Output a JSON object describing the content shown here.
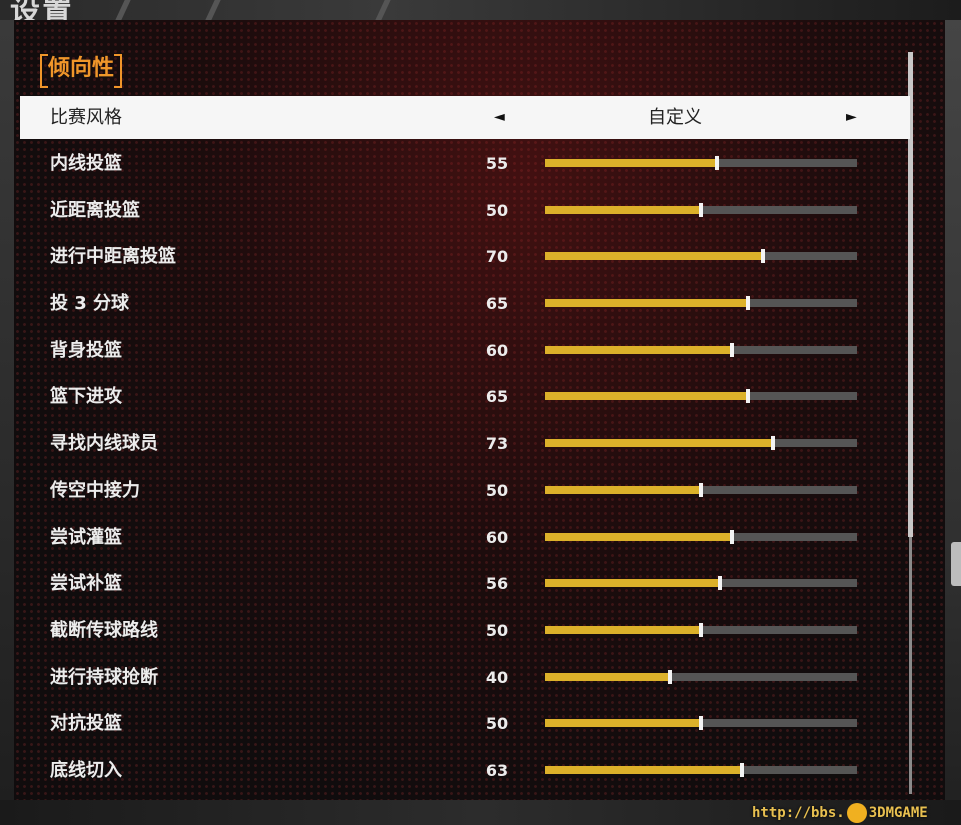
{
  "header": {
    "title_fragment": "设置"
  },
  "section": {
    "title": "倾向性"
  },
  "style_selector": {
    "label": "比赛风格",
    "value": "自定义",
    "left_arrow": "◄",
    "right_arrow": "►"
  },
  "sliders": [
    {
      "label": "内线投篮",
      "value": 55
    },
    {
      "label": "近距离投篮",
      "value": 50
    },
    {
      "label": "进行中距离投篮",
      "value": 70
    },
    {
      "label": "投 3 分球",
      "value": 65
    },
    {
      "label": "背身投篮",
      "value": 60
    },
    {
      "label": "篮下进攻",
      "value": 65
    },
    {
      "label": "寻找内线球员",
      "value": 73
    },
    {
      "label": "传空中接力",
      "value": 50
    },
    {
      "label": "尝试灌篮",
      "value": 60
    },
    {
      "label": "尝试补篮",
      "value": 56
    },
    {
      "label": "截断传球路线",
      "value": 50
    },
    {
      "label": "进行持球抢断",
      "value": 40
    },
    {
      "label": "对抗投篮",
      "value": 50
    },
    {
      "label": "底线切入",
      "value": 63
    }
  ],
  "slider_max": 100,
  "watermark": {
    "text_left": "http://bbs.",
    "text_right": "3DMGAME"
  },
  "colors": {
    "accent": "#f0962a",
    "slider_fill": "#dcb12a",
    "slider_track": "#555555",
    "selected_row": "#f6f6f6"
  }
}
